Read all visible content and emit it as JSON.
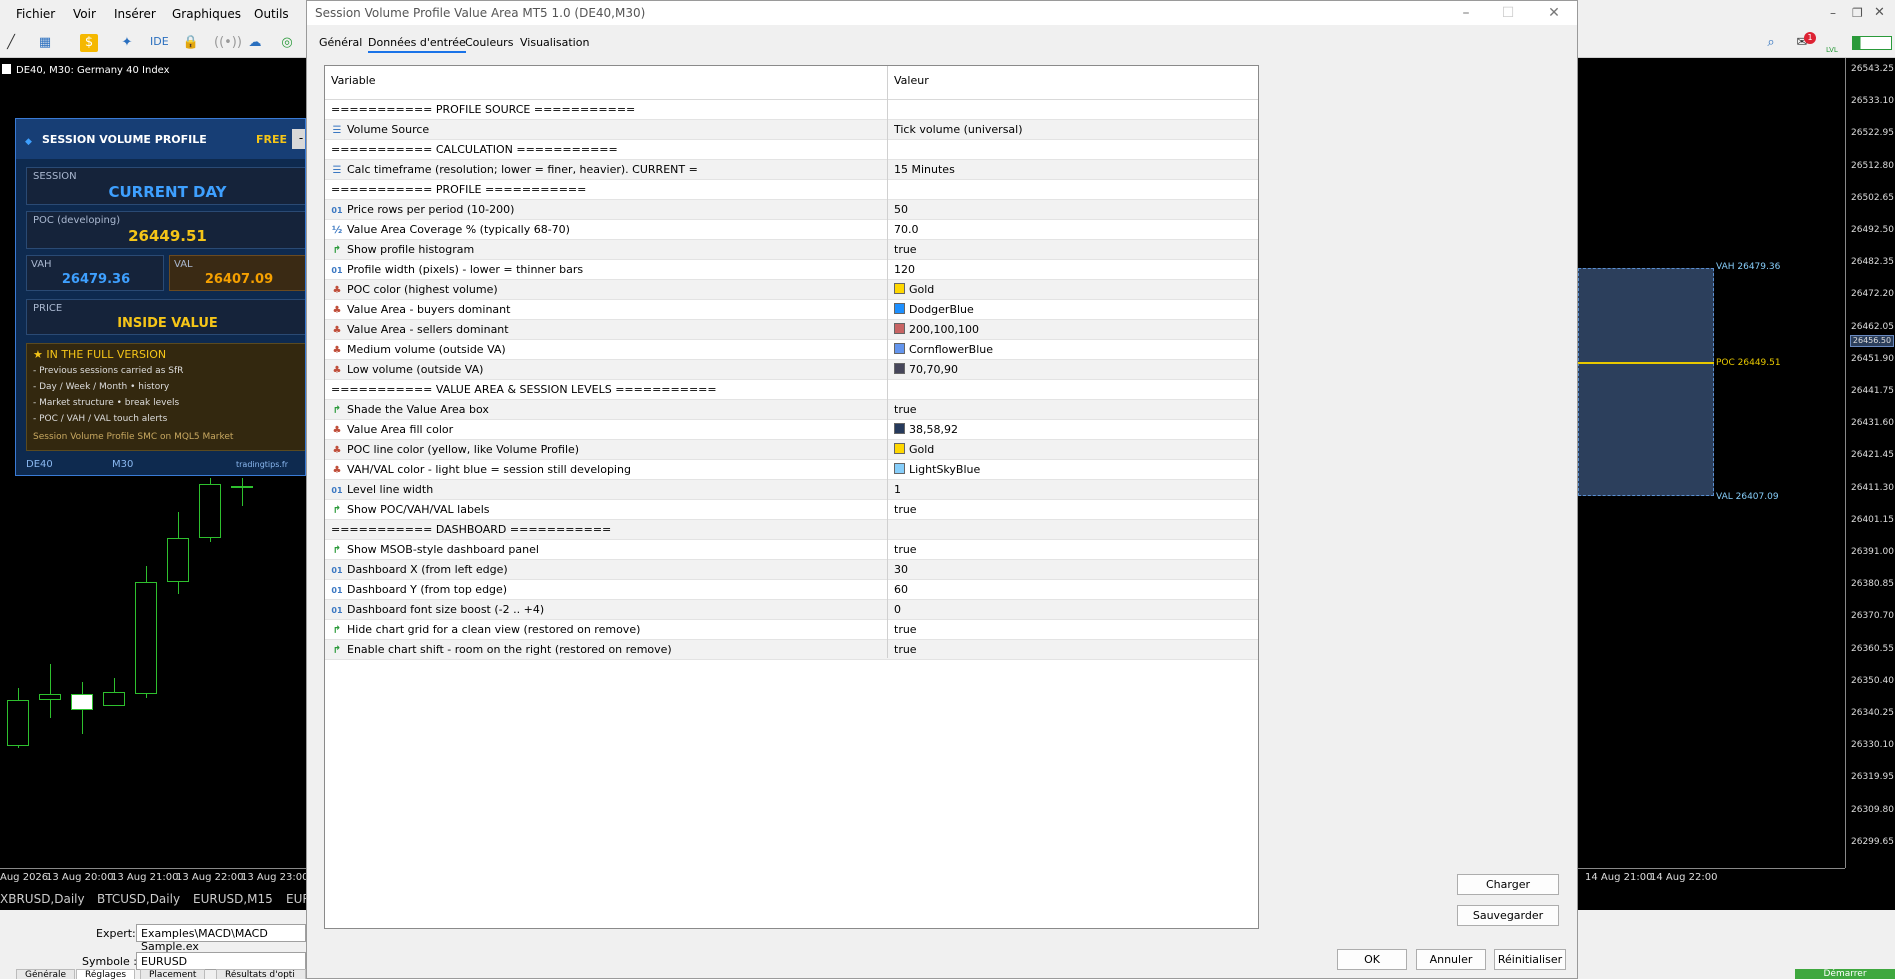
{
  "menubar": {
    "items": [
      "Fichier",
      "Voir",
      "Insérer",
      "Graphiques",
      "Outils"
    ]
  },
  "toolbar": {
    "ide_label": "IDE",
    "notification_count": "1",
    "lvl_label": "LVL"
  },
  "chart_left": {
    "title": "DE40, M30:  Germany 40 Index"
  },
  "dashboard": {
    "title": "SESSION VOLUME PROFILE",
    "badge": "FREE",
    "session_label": "SESSION",
    "session_value": "CURRENT DAY",
    "poc_label": "POC (developing)",
    "poc_value": "26449.51",
    "vah_label": "VAH",
    "vah_value": "26479.36",
    "val_label": "VAL",
    "val_value": "26407.09",
    "price_label": "PRICE",
    "price_value": "INSIDE VALUE",
    "full_title": "★ IN THE FULL VERSION",
    "full_items": [
      "- Previous sessions carried as SfR",
      "- Day / Week / Month • history",
      "- Market structure • break levels",
      "- POC / VAH / VAL touch alerts"
    ],
    "full_footer": "Session Volume Profile SMC on MQL5 Market",
    "footer_symbol": "DE40",
    "footer_tf": "M30",
    "footer_site": "tradingtips.fr"
  },
  "chart_right": {
    "vah_label": "VAH 26479.36",
    "poc_label": "POC 26449.51",
    "val_label": "VAL 26407.09",
    "price_marker": "26456.50"
  },
  "price_scale": [
    "26543.25",
    "26533.10",
    "26522.95",
    "26512.80",
    "26502.65",
    "26492.50",
    "26482.35",
    "26472.20",
    "26462.05",
    "26451.90",
    "26441.75",
    "26431.60",
    "26421.45",
    "26411.30",
    "26401.15",
    "26391.00",
    "26380.85",
    "26370.70",
    "26360.55",
    "26350.40",
    "26340.25",
    "26330.10",
    "26319.95",
    "26309.80",
    "26299.65"
  ],
  "time_axis_left": [
    "Aug 2026",
    "13 Aug 20:00",
    "13 Aug 21:00",
    "13 Aug 22:00",
    "13 Aug 23:00"
  ],
  "time_axis_right": [
    "14 Aug 21:00",
    "14 Aug 22:00"
  ],
  "symbol_tabs": [
    "XBRUSD,Daily",
    "BTCUSD,Daily",
    "EURUSD,M15",
    "EUR"
  ],
  "bottom_panel": {
    "expert_label": "Expert:",
    "expert_value": "Examples\\MACD\\MACD Sample.ex",
    "symbol_label": "Symbole :",
    "symbol_value": "EURUSD",
    "tabs": [
      "Générale",
      "Réglages",
      "Placement",
      "Résultats d'opti"
    ],
    "start_button": "Démarrer"
  },
  "dialog": {
    "title": "Session Volume Profile Value Area MT5 1.0 (DE40,M30)",
    "tabs": [
      "Général",
      "Données d'entrée",
      "Couleurs",
      "Visualisation"
    ],
    "active_tab": "Données d'entrée",
    "col_variable": "Variable",
    "col_value": "Valeur",
    "btn_load": "Charger",
    "btn_save": "Sauvegarder",
    "btn_ok": "OK",
    "btn_cancel": "Annuler",
    "btn_reset": "Réinitialiser",
    "rows": [
      {
        "icon": "",
        "name": "=========== PROFILE SOURCE ===========",
        "value": "",
        "swatch": ""
      },
      {
        "icon": "enum",
        "name": "Volume Source",
        "value": "Tick volume (universal)",
        "swatch": ""
      },
      {
        "icon": "",
        "name": "=========== CALCULATION ===========",
        "value": "",
        "swatch": ""
      },
      {
        "icon": "enum",
        "name": "Calc timeframe (resolution; lower = finer, heavier). CURRENT =",
        "value": "15 Minutes",
        "swatch": ""
      },
      {
        "icon": "",
        "name": "=========== PROFILE ===========",
        "value": "",
        "swatch": ""
      },
      {
        "icon": "int",
        "name": "Price rows per period (10-200)",
        "value": "50",
        "swatch": ""
      },
      {
        "icon": "dbl",
        "name": "Value Area Coverage % (typically 68-70)",
        "value": "70.0",
        "swatch": ""
      },
      {
        "icon": "bool",
        "name": "Show profile histogram",
        "value": "true",
        "swatch": ""
      },
      {
        "icon": "int",
        "name": "Profile width (pixels) - lower = thinner bars",
        "value": "120",
        "swatch": ""
      },
      {
        "icon": "col",
        "name": "POC color (highest volume)",
        "value": "Gold",
        "swatch": "#ffd700"
      },
      {
        "icon": "col",
        "name": "Value Area - buyers dominant",
        "value": "DodgerBlue",
        "swatch": "#1e90ff"
      },
      {
        "icon": "col",
        "name": "Value Area - sellers dominant",
        "value": "200,100,100",
        "swatch": "#c86464"
      },
      {
        "icon": "col",
        "name": "Medium volume (outside VA)",
        "value": "CornflowerBlue",
        "swatch": "#6495ed"
      },
      {
        "icon": "col",
        "name": "Low volume (outside VA)",
        "value": "70,70,90",
        "swatch": "#46465a"
      },
      {
        "icon": "",
        "name": "=========== VALUE AREA & SESSION LEVELS ===========",
        "value": "",
        "swatch": ""
      },
      {
        "icon": "bool",
        "name": "Shade the Value Area box",
        "value": "true",
        "swatch": ""
      },
      {
        "icon": "col",
        "name": "Value Area fill color",
        "value": "38,58,92",
        "swatch": "#263a5c"
      },
      {
        "icon": "col",
        "name": "POC line color (yellow, like Volume Profile)",
        "value": "Gold",
        "swatch": "#ffd700"
      },
      {
        "icon": "col",
        "name": "VAH/VAL color - light blue = session still developing",
        "value": "LightSkyBlue",
        "swatch": "#87cefa"
      },
      {
        "icon": "int",
        "name": "Level line width",
        "value": "1",
        "swatch": ""
      },
      {
        "icon": "bool",
        "name": "Show POC/VAH/VAL labels",
        "value": "true",
        "swatch": ""
      },
      {
        "icon": "",
        "name": "=========== DASHBOARD ===========",
        "value": "",
        "swatch": ""
      },
      {
        "icon": "bool",
        "name": "Show MSOB-style dashboard panel",
        "value": "true",
        "swatch": ""
      },
      {
        "icon": "int",
        "name": "Dashboard X (from left edge)",
        "value": "30",
        "swatch": ""
      },
      {
        "icon": "int",
        "name": "Dashboard Y (from top edge)",
        "value": "60",
        "swatch": ""
      },
      {
        "icon": "int",
        "name": "Dashboard font size boost (-2 .. +4)",
        "value": "0",
        "swatch": ""
      },
      {
        "icon": "bool",
        "name": "Hide chart grid for a clean view (restored on remove)",
        "value": "true",
        "swatch": ""
      },
      {
        "icon": "bool",
        "name": "Enable chart shift - room on the right (restored on remove)",
        "value": "true",
        "swatch": ""
      }
    ]
  },
  "colors": {
    "accent": "#1a73e8",
    "candle": "#2ec02e",
    "poc": "#e8c800",
    "dash_gold": "#f5c518",
    "dash_blue": "#3ea0ff"
  }
}
